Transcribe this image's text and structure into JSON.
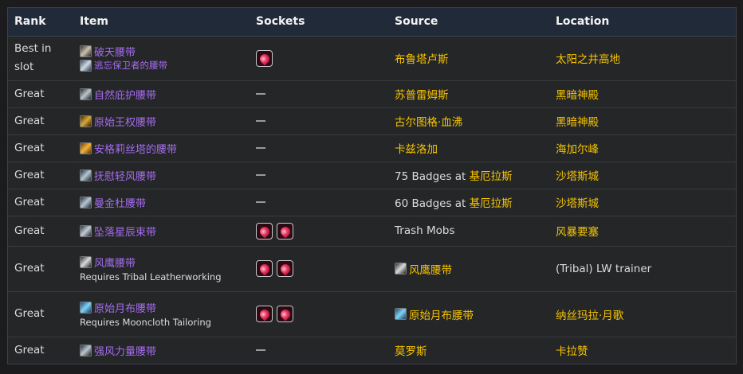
{
  "headers": {
    "rank": "Rank",
    "item": "Item",
    "sockets": "Sockets",
    "source": "Source",
    "location": "Location"
  },
  "rows": [
    {
      "rank": "Best in slot",
      "items": [
        {
          "name": "破天腰带",
          "icon": "belt-icon"
        },
        {
          "name": "逃忘保卫者的腰带",
          "icon": "belt-icon"
        }
      ],
      "sockets": 1,
      "source": "布鲁塔卢斯",
      "location": "太阳之井高地"
    },
    {
      "rank": "Great",
      "items": [
        {
          "name": "自然庇护腰带",
          "icon": "belt-icon"
        }
      ],
      "sockets": 0,
      "source": "苏普雷姆斯",
      "location": "黑暗神殿"
    },
    {
      "rank": "Great",
      "items": [
        {
          "name": "原始王权腰带",
          "icon": "belt-icon"
        }
      ],
      "sockets": 0,
      "source": "古尔图格·血沸",
      "location": "黑暗神殿"
    },
    {
      "rank": "Great",
      "items": [
        {
          "name": "安格莉丝塔的腰带",
          "icon": "belt-icon"
        }
      ],
      "sockets": 0,
      "source": "卡兹洛加",
      "location": "海加尔峰"
    },
    {
      "rank": "Great",
      "items": [
        {
          "name": "抚慰轻风腰带",
          "icon": "belt-icon"
        }
      ],
      "sockets": 0,
      "source_prefix": "75 Badges at ",
      "source": "基厄拉斯",
      "location": "沙塔斯城"
    },
    {
      "rank": "Great",
      "items": [
        {
          "name": "曼金杜腰带",
          "icon": "belt-icon"
        }
      ],
      "sockets": 0,
      "source_prefix": "60 Badges at ",
      "source": "基厄拉斯",
      "location": "沙塔斯城"
    },
    {
      "rank": "Great",
      "items": [
        {
          "name": "坠落星辰束带",
          "icon": "belt-icon"
        }
      ],
      "sockets": 2,
      "source_plain": "Trash Mobs",
      "location": "风暴要塞"
    },
    {
      "rank": "Great",
      "items": [
        {
          "name": "风鹰腰带",
          "icon": "belt-icon"
        }
      ],
      "requirement": "Requires Tribal Leatherworking",
      "sockets": 2,
      "source_item": "风鹰腰带",
      "location_plain": "(Tribal) LW trainer"
    },
    {
      "rank": "Great",
      "items": [
        {
          "name": "原始月布腰带",
          "icon": "belt-icon"
        }
      ],
      "requirement": "Requires Mooncloth Tailoring",
      "sockets": 2,
      "source_item": "原始月布腰带",
      "location": "纳丝玛拉·月歌"
    },
    {
      "rank": "Great",
      "items": [
        {
          "name": "强风力量腰带",
          "icon": "belt-icon"
        }
      ],
      "sockets": 0,
      "source": "莫罗斯",
      "location": "卡拉赞"
    }
  ],
  "colors": {
    "item": "#a56cf0",
    "gold": "#f6c400",
    "header_bg": "#212a38"
  }
}
